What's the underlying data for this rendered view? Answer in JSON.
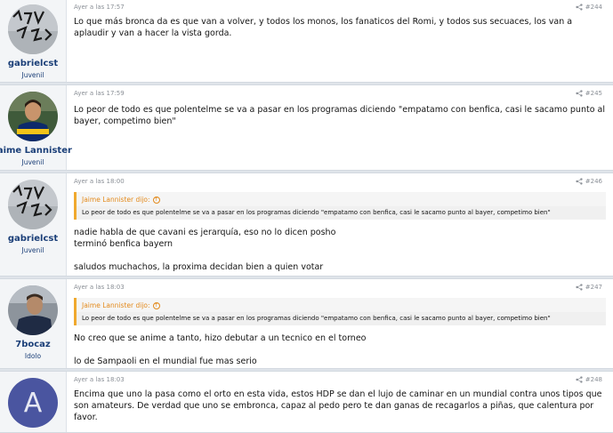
{
  "posts": [
    {
      "user": {
        "name": "gabrielcst",
        "role": "Juvenil",
        "avatar": "graffiti-avatar"
      },
      "time": "Ayer a las 17:57",
      "number": "#244",
      "quote": null,
      "body": "Lo que más bronca da es que van a volver, y todos los monos, los fanaticos del Romi, y todos sus secuaces, los van a aplaudir y van a hacer la vista gorda."
    },
    {
      "user": {
        "name": "Jaime Lannister",
        "role": "Juvenil",
        "avatar": "player-avatar"
      },
      "time": "Ayer a las 17:59",
      "number": "#245",
      "quote": null,
      "body": "Lo peor de todo es que polentelme se va a pasar en los programas diciendo \"empatamo con benfica, casi le sacamo punto al bayer, competimo bien\""
    },
    {
      "user": {
        "name": "gabrielcst",
        "role": "Juvenil",
        "avatar": "graffiti-avatar"
      },
      "time": "Ayer a las 18:00",
      "number": "#246",
      "quote": {
        "author": "Jaime Lannister dijo:",
        "text": "Lo peor de todo es que polentelme se va a pasar en los programas diciendo \"empatamo con benfica, casi le sacamo punto al bayer, competimo bien\""
      },
      "body": "nadie habla de que cavani es jerarquía, eso no lo dicen posho\nterminó benfica bayern\n\nsaludos muchachos, la proxima decidan bien a quien votar"
    },
    {
      "user": {
        "name": "7bocaz",
        "role": "Idolo",
        "avatar": "coach-avatar"
      },
      "time": "Ayer a las 18:03",
      "number": "#247",
      "quote": {
        "author": "Jaime Lannister dijo:",
        "text": "Lo peor de todo es que polentelme se va a pasar en los programas diciendo \"empatamo con benfica, casi le sacamo punto al bayer, competimo bien\""
      },
      "body": "No creo que se anime a tanto, hizo debutar a un tecnico en el torneo\n\nlo de Sampaoli en el mundial fue mas serio"
    },
    {
      "user": {
        "name": "",
        "role": "",
        "avatar": "letter-avatar",
        "letter": "A"
      },
      "time": "Ayer a las 18:03",
      "number": "#248",
      "quote": null,
      "body": "Encima que uno la pasa como el orto en esta vida, estos HDP se dan el lujo de caminar en un mundial contra unos tipos que son amateurs. De verdad que uno se embronca, capaz al pedo pero te dan ganas de recagarlos a piñas, que calentura por favor."
    }
  ],
  "colors": {
    "username": "#1b3f78",
    "quote_accent": "#e38a1c",
    "letter_avatar_bg": "#4a55a0"
  }
}
